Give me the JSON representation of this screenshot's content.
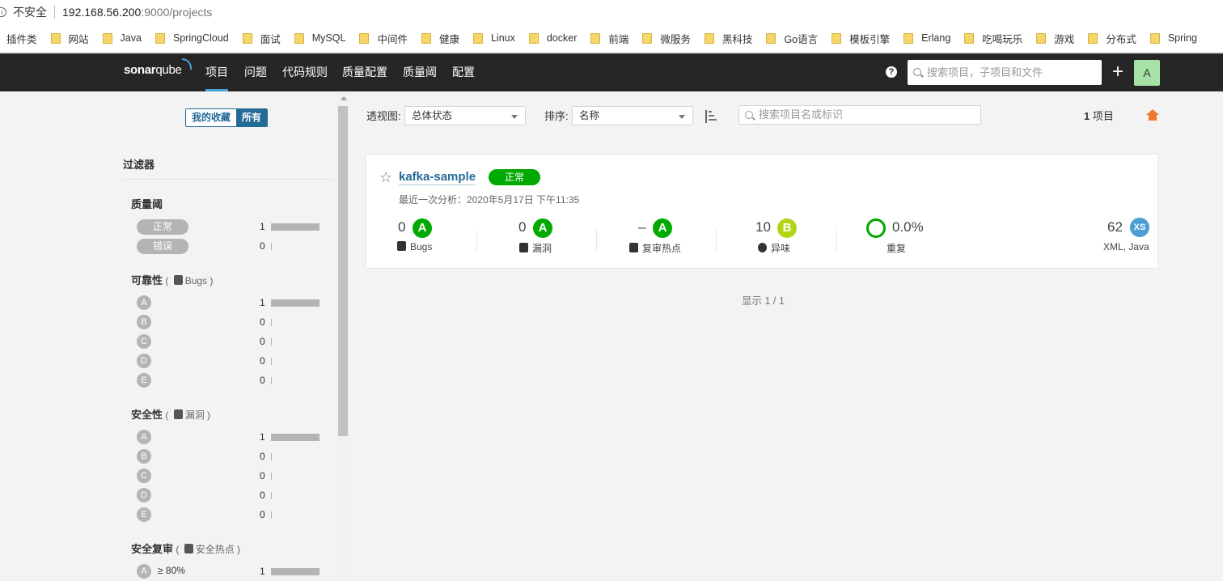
{
  "browser": {
    "insecure_label": "不安全",
    "url_host": "192.168.56.200",
    "url_path": ":9000/projects",
    "bookmarks": [
      "插件类",
      "网站",
      "Java",
      "SpringCloud",
      "面试",
      "MySQL",
      "中间件",
      "健康",
      "Linux",
      "docker",
      "前端",
      "微服务",
      "黑科技",
      "Go语言",
      "模板引擎",
      "Erlang",
      "吃喝玩乐",
      "游戏",
      "分布式",
      "Spring"
    ]
  },
  "nav": {
    "logo_a": "sonar",
    "logo_b": "qube",
    "items": [
      "项目",
      "问题",
      "代码规则",
      "质量配置",
      "质量阈",
      "配置"
    ],
    "help": "?",
    "search_placeholder": "搜索项目，子项目和文件",
    "plus": "+",
    "avatar": "A"
  },
  "sidebar": {
    "fav_label": "我的收藏",
    "all_label": "所有",
    "filter_title": "过滤器",
    "quality_gate": {
      "title": "质量阈",
      "rows": [
        {
          "label": "正常",
          "count": "1",
          "fraction": 1
        },
        {
          "label": "错误",
          "count": "0",
          "fraction": 0
        }
      ]
    },
    "reliability": {
      "title": "可靠性",
      "sub": "Bugs",
      "rows": [
        {
          "label": "A",
          "count": "1",
          "fraction": 1
        },
        {
          "label": "B",
          "count": "0",
          "fraction": 0
        },
        {
          "label": "C",
          "count": "0",
          "fraction": 0
        },
        {
          "label": "D",
          "count": "0",
          "fraction": 0
        },
        {
          "label": "E",
          "count": "0",
          "fraction": 0
        }
      ]
    },
    "security": {
      "title": "安全性",
      "sub": "漏洞",
      "rows": [
        {
          "label": "A",
          "count": "1",
          "fraction": 1
        },
        {
          "label": "B",
          "count": "0",
          "fraction": 0
        },
        {
          "label": "C",
          "count": "0",
          "fraction": 0
        },
        {
          "label": "D",
          "count": "0",
          "fraction": 0
        },
        {
          "label": "E",
          "count": "0",
          "fraction": 0
        }
      ]
    },
    "security_review": {
      "title": "安全复审",
      "sub": "安全热点",
      "rows": [
        {
          "label": "A",
          "extra": "≥ 80%",
          "count": "1",
          "fraction": 1
        }
      ]
    }
  },
  "main": {
    "perspective_label": "透视图:",
    "perspective_value": "总体状态",
    "sort_label": "排序:",
    "sort_value": "名称",
    "search_placeholder": "搜索项目名或标识",
    "count_num": "1",
    "count_unit": "项目",
    "showing": "显示 1 / 1",
    "project": {
      "name": "kafka-sample",
      "status": "正常",
      "analysis": "最近一次分析：2020年5月17日 下午11:35",
      "bugs": {
        "value": "0",
        "rating": "A",
        "label": "Bugs"
      },
      "vulns": {
        "value": "0",
        "rating": "A",
        "label": "漏洞"
      },
      "hotspots": {
        "value": "–",
        "rating": "A",
        "label": "复审热点"
      },
      "smells": {
        "value": "10",
        "rating": "B",
        "label": "异味"
      },
      "duplications": {
        "value": "0.0%",
        "label": "重复"
      },
      "size": {
        "value": "62",
        "badge": "XS",
        "languages": "XML, Java"
      }
    }
  },
  "colors": {
    "nav_bg": "#262626",
    "accent": "#236a97",
    "rating_a": "#00aa00",
    "rating_b": "#b0d513",
    "filter_grey": "#b4b4b4",
    "home": "#f0782a"
  }
}
